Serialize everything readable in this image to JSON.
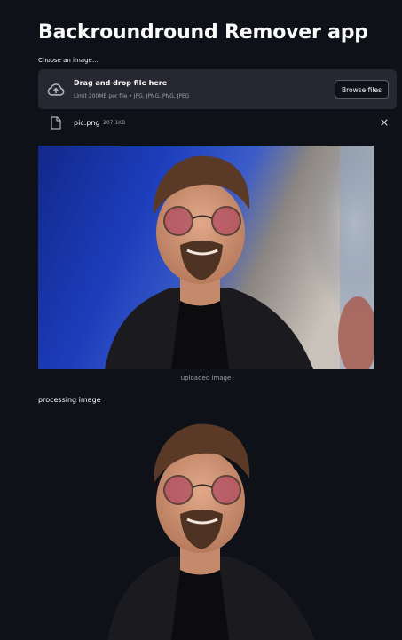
{
  "app": {
    "title": "Backroundround Remover app"
  },
  "uploader": {
    "label": "Choose an image...",
    "drop_title": "Drag and drop file here",
    "limit_text": "Limit 200MB per file • JPG, JPNG, PNG, JPEG",
    "browse_label": "Browse files",
    "icon": "cloud-upload-icon"
  },
  "uploaded_file": {
    "name": "pic.png",
    "size": "207.1KB",
    "icon": "file-icon",
    "remove_icon": "close-icon"
  },
  "original_image": {
    "caption": "uploaded image"
  },
  "processing": {
    "label": "processing image"
  },
  "colors": {
    "background": "#0e1117",
    "dropzone": "#262730",
    "text": "#fafafa",
    "muted": "#9da0a8"
  }
}
